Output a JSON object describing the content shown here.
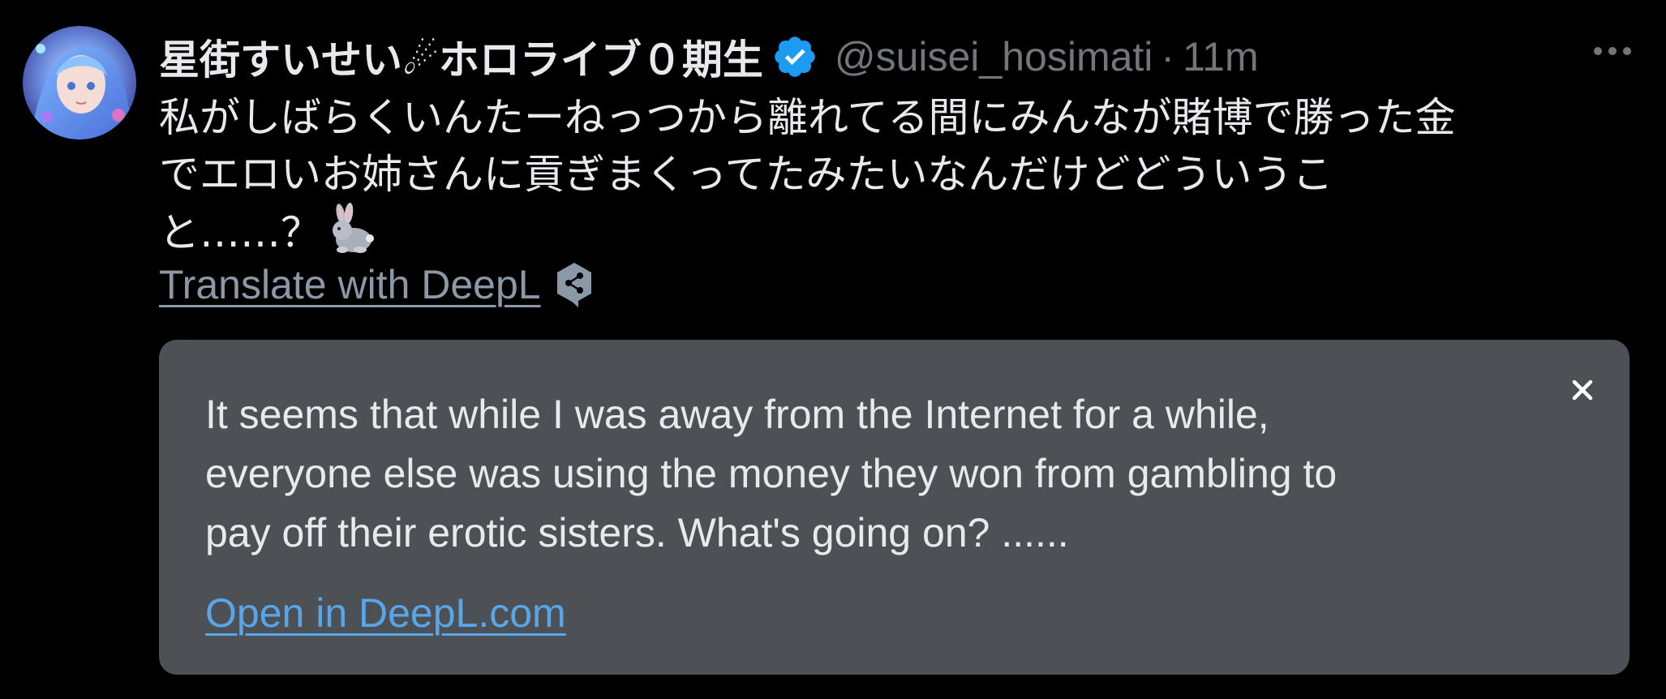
{
  "tweet": {
    "author": {
      "display_name": "星街すいせい☄ホロライブ０期生",
      "handle": "@suisei_hosimati",
      "verified_icon": "verified-badge-icon",
      "avatar_icon": "avatar"
    },
    "separator": "·",
    "time": "11m",
    "more_icon": "more-horizontal-icon",
    "text_lines": [
      "私がしばらくいんたーねっつから離れてる間にみんなが賭博で勝った金",
      "でエロいお姉さんに貢ぎまくってたみたいなんだけどどういうこ",
      "と……？"
    ],
    "emoji_icon": "rabbit-icon"
  },
  "translate": {
    "link_label": "Translate with DeepL",
    "icon": "deepl-icon"
  },
  "translation_card": {
    "close_icon": "close-icon",
    "text_lines": [
      "It seems that while I was away from the Internet for a while,",
      "everyone else was using the money they won from gambling to",
      "pay off their erotic sisters. What's going on? ......"
    ],
    "open_link_label": "Open in DeepL.com"
  },
  "colors": {
    "background": "#000000",
    "primary_text": "#e7e9ea",
    "secondary_text": "#71767b",
    "verified_blue": "#1d9bf0",
    "card_background": "#4d5156",
    "link_blue": "#58a6e8"
  }
}
